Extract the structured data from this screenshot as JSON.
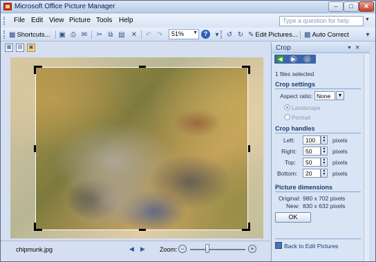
{
  "window": {
    "title": "Microsoft Office Picture Manager"
  },
  "menu": [
    "File",
    "Edit",
    "View",
    "Picture",
    "Tools",
    "Help"
  ],
  "help_box": {
    "placeholder": "Type a question for help"
  },
  "toolbar": {
    "shortcuts_label": "Shortcuts...",
    "zoom_value": "51%",
    "edit_pictures_label": "Edit Pictures...",
    "auto_correct_label": "Auto Correct"
  },
  "status": {
    "filename": "chipmunk.jpg",
    "zoom_label": "Zoom:"
  },
  "pane": {
    "title": "Crop",
    "files_selected": "1 files selected",
    "crop_settings": "Crop settings",
    "aspect_label": "Aspect ratio:",
    "aspect_value": "None",
    "landscape": "Landscape",
    "portrait": "Portrait",
    "crop_handles": "Crop handles",
    "handles": [
      {
        "label": "Left:",
        "value": "100",
        "unit": "pixels"
      },
      {
        "label": "Right:",
        "value": "50",
        "unit": "pixels"
      },
      {
        "label": "Top:",
        "value": "50",
        "unit": "pixels"
      },
      {
        "label": "Bottom:",
        "value": "20",
        "unit": "pixels"
      }
    ],
    "dimensions_head": "Picture dimensions",
    "original_label": "Original:",
    "original_value": "980 x 702 pixels",
    "new_label": "New:",
    "new_value": "830 x 632 pixels",
    "ok_label": "OK",
    "back_label": "Back to Edit Pictures"
  }
}
